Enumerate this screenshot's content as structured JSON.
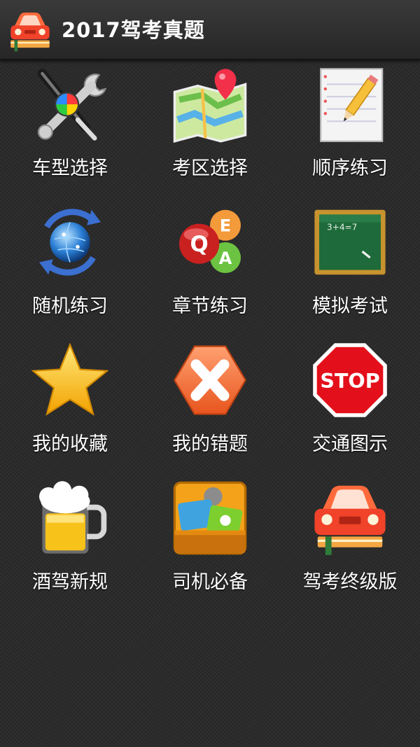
{
  "app": {
    "title": "2017驾考真题",
    "icon": "red-car-book-icon"
  },
  "menu": [
    {
      "label": "车型选择",
      "icon": "tools-wrench-screwdriver-icon"
    },
    {
      "label": "考区选择",
      "icon": "map-pin-icon"
    },
    {
      "label": "顺序练习",
      "icon": "notepad-pencil-icon"
    },
    {
      "label": "随机练习",
      "icon": "globe-refresh-icon"
    },
    {
      "label": "章节练习",
      "icon": "qa-bubbles-icon"
    },
    {
      "label": "模拟考试",
      "icon": "chalkboard-icon",
      "board_text": "3+4=7"
    },
    {
      "label": "我的收藏",
      "icon": "star-icon"
    },
    {
      "label": "我的错题",
      "icon": "x-mark-hexagon-icon"
    },
    {
      "label": "交通图示",
      "icon": "stop-sign-icon",
      "sign_text": "STOP"
    },
    {
      "label": "酒驾新规",
      "icon": "beer-mug-icon"
    },
    {
      "label": "司机必备",
      "icon": "toolbox-icon"
    },
    {
      "label": "驾考终级版",
      "icon": "red-car-book-icon"
    }
  ],
  "colors": {
    "background": "#2c2c2c",
    "titlebar": "#303030",
    "text": "#ffffff"
  }
}
